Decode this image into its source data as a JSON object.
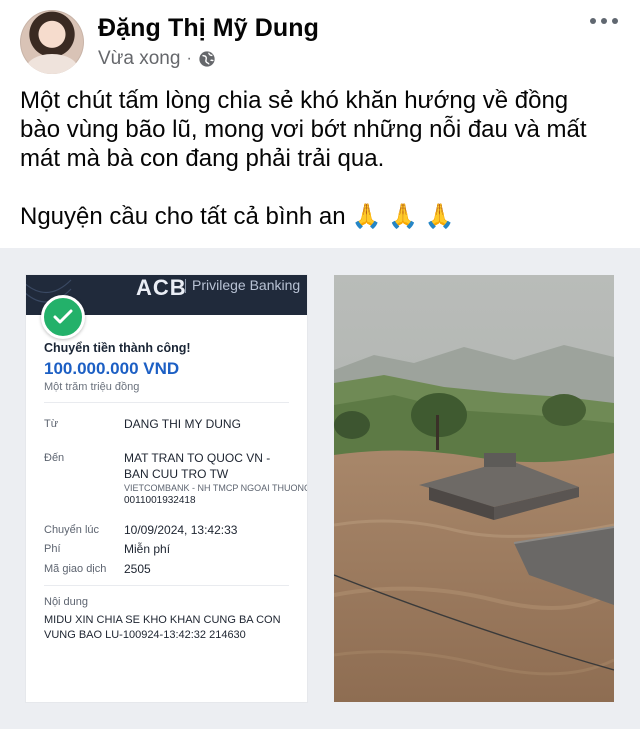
{
  "post": {
    "author": "Đặng Thị Mỹ Dung",
    "time": "Vừa xong",
    "separator": "·",
    "privacy_icon": "globe-icon",
    "more_icon": "more-options-icon",
    "text_line1": "Một chút tấm lòng chia sẻ khó khăn hướng về đồng",
    "text_line2": "bào vùng bão lũ, mong vơi bớt những nỗi đau và mất",
    "text_line3": "mát mà bà con đang phải trải qua.",
    "text_line4": "Nguyện cầu cho tất cả bình an",
    "pray_emoji": "🙏 🙏 🙏"
  },
  "receipt": {
    "bank_logo": "ACB",
    "bank_tagline": "Privilege Banking",
    "status": "Chuyển tiền thành công!",
    "amount": "100.000.000 VND",
    "amount_words": "Một trăm triệu đồng",
    "from_label": "Từ",
    "from_value": "DANG THI MY DUNG",
    "to_label": "Đến",
    "to_value_line1": "MAT TRAN TO QUOC VN -",
    "to_value_line2": "BAN CUU TRO TW",
    "to_bank": "VIETCOMBANK - NH TMCP NGOAI THUONG",
    "to_account": "0011001932418",
    "time_label": "Chuyển lúc",
    "time_value": "10/09/2024, 13:42:33",
    "fee_label": "Phí",
    "fee_value": "Miễn phí",
    "txn_label": "Mã giao dịch",
    "txn_value": "2505",
    "content_label": "Nội dung",
    "content_line1": "MIDU XIN CHIA SE KHO KHAN CUNG BA CON",
    "content_line2": "VUNG BAO LU-100924-13:42:32 214630"
  },
  "colors": {
    "amount_blue": "#1c5fc4",
    "success_green": "#23b16a",
    "header_navy": "#202a3b",
    "meta_gray": "#65676b"
  }
}
